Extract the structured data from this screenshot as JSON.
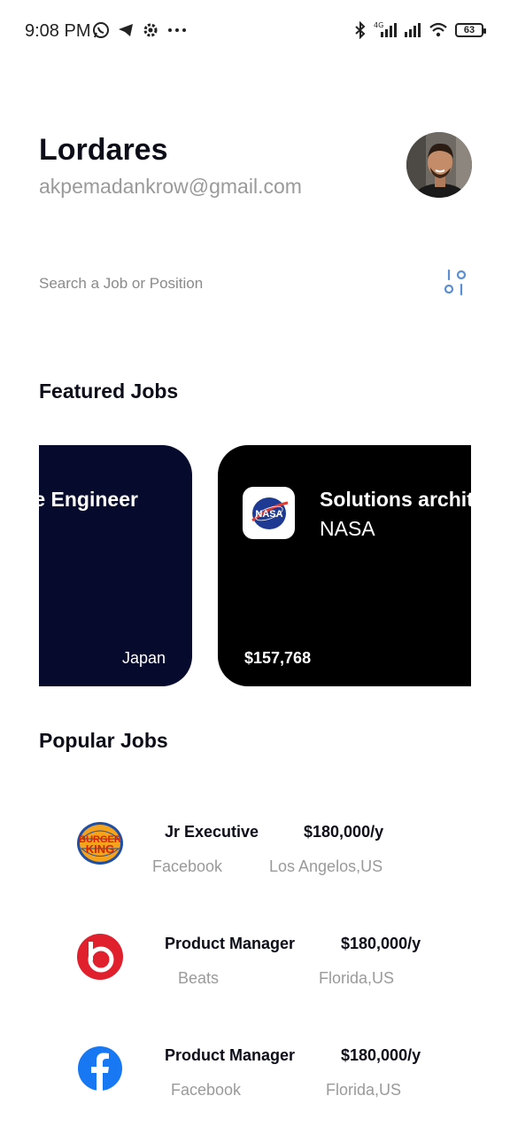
{
  "status_bar": {
    "time": "9:08 PM",
    "battery": "63",
    "left_icons": [
      "whatsapp-icon",
      "telegram-icon",
      "settings-icon",
      "more-icon"
    ],
    "right_icons": [
      "bluetooth-icon",
      "signal-4g-icon",
      "signal-icon",
      "wifi-icon",
      "battery-icon"
    ]
  },
  "profile": {
    "name": "Lordares",
    "email": "akpemadankrow@gmail.com",
    "avatar_icon": "user-avatar"
  },
  "search": {
    "placeholder": "Search a Job or Position",
    "filter_icon": "filter-icon"
  },
  "featured": {
    "title": "Featured Jobs",
    "cards": [
      {
        "title": "Software Engineer",
        "location": "Japan",
        "bg": "#060a2d"
      },
      {
        "title": "Solutions architect",
        "company": "NASA",
        "salary": "$157,768",
        "logo_text": "NASA",
        "bg": "#000000"
      }
    ]
  },
  "popular": {
    "title": "Popular Jobs",
    "jobs": [
      {
        "title": "Jr Executive",
        "salary": "$180,000/y",
        "company": "Facebook",
        "location": "Los Angelos,US",
        "logo": "burger-king-logo"
      },
      {
        "title": "Product Manager",
        "salary": "$180,000/y",
        "company": "Beats",
        "location": "Florida,US",
        "logo": "beats-logo"
      },
      {
        "title": "Product Manager",
        "salary": "$180,000/y",
        "company": "Facebook",
        "location": "Florida,US",
        "logo": "facebook-logo"
      }
    ]
  },
  "colors": {
    "primary_text": "#0d0d1a",
    "muted_text": "#9a9a9a",
    "card_navy": "#060a2d",
    "card_black": "#000000",
    "facebook_blue": "#1877f2",
    "beats_red": "#e0202d",
    "bk_red": "#d62300",
    "bk_orange": "#f5a31a",
    "filter_blue": "#5b8fd1"
  }
}
